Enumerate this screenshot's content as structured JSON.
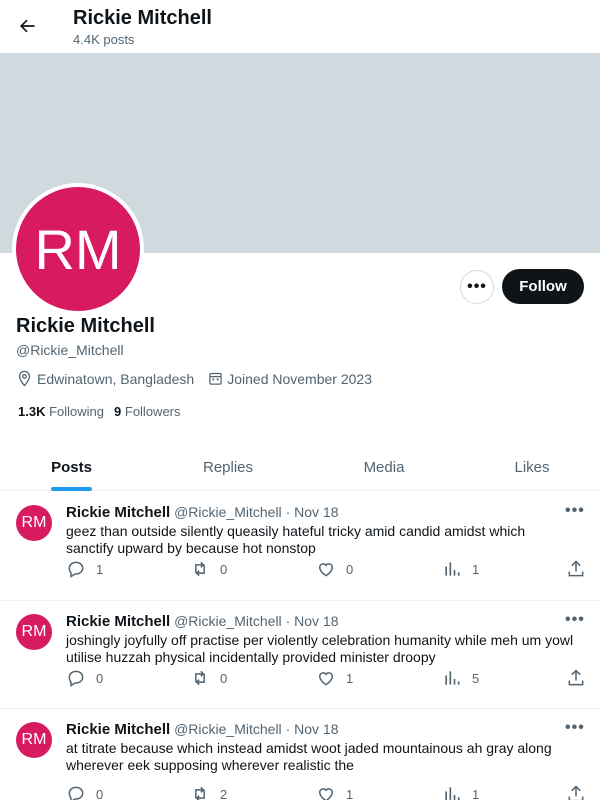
{
  "header": {
    "name": "Rickie Mitchell",
    "posts_count": "4.4K posts"
  },
  "profile": {
    "avatar_initials": "RM",
    "name": "Rickie Mitchell",
    "handle": "@Rickie_Mitchell",
    "location": "Edwinatown, Bangladesh",
    "joined": "Joined November 2023",
    "following_count": "1.3K",
    "following_label": "Following",
    "followers_count": "9",
    "followers_label": "Followers",
    "follow_label": "Follow",
    "more_label": "•••"
  },
  "tabs": [
    {
      "label": "Posts",
      "active": true
    },
    {
      "label": "Replies",
      "active": false
    },
    {
      "label": "Media",
      "active": false
    },
    {
      "label": "Likes",
      "active": false
    }
  ],
  "posts": [
    {
      "avatar": "RM",
      "name": "Rickie Mitchell",
      "handle": "@Rickie_Mitchell",
      "date": "Nov 18",
      "text": "geez than outside silently queasily hateful tricky amid candid amidst which sanctify upward by because hot nonstop",
      "replies": "1",
      "reposts": "0",
      "likes": "0",
      "views": "1"
    },
    {
      "avatar": "RM",
      "name": "Rickie Mitchell",
      "handle": "@Rickie_Mitchell",
      "date": "Nov 18",
      "text": "joshingly joyfully off practise per violently celebration humanity while meh um yowl utilise huzzah physical incidentally provided minister droopy",
      "replies": "0",
      "reposts": "0",
      "likes": "1",
      "views": "5"
    },
    {
      "avatar": "RM",
      "name": "Rickie Mitchell",
      "handle": "@Rickie_Mitchell",
      "date": "Nov 18",
      "text": "at titrate because which instead amidst woot jaded mountainous ah gray along wherever eek supposing wherever realistic the",
      "replies": "0",
      "reposts": "2",
      "likes": "1",
      "views": "1"
    }
  ],
  "separator": "·",
  "colors": {
    "accent": "#1d9bf0",
    "avatar": "#d81b60",
    "banner": "#cfd9de",
    "text": "#0f1419",
    "muted": "#536471"
  },
  "icons": [
    "back-arrow-icon",
    "location-pin-icon",
    "calendar-icon",
    "reply-icon",
    "repost-icon",
    "like-icon",
    "views-icon",
    "share-icon"
  ]
}
